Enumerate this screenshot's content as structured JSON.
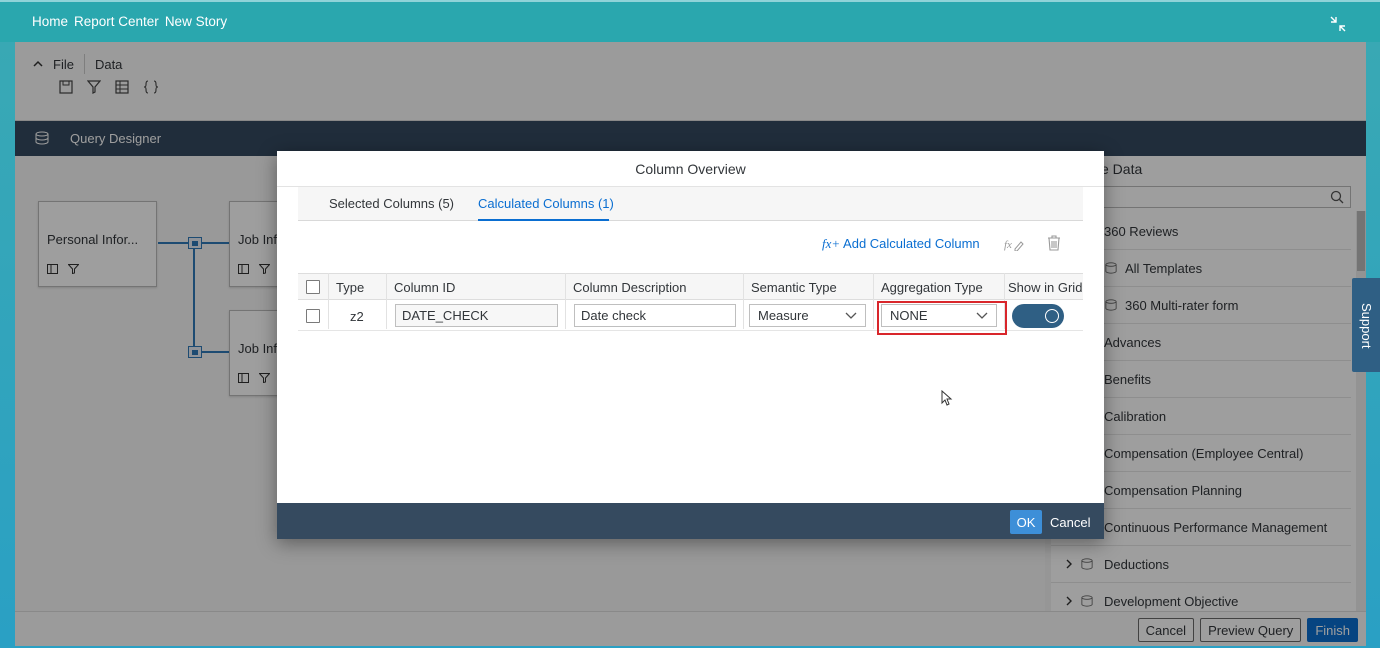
{
  "breadcrumb": [
    "Home",
    "Report Center",
    "New Story"
  ],
  "toolbar": {
    "file_label": "File",
    "data_label": "Data"
  },
  "query_designer": {
    "label": "Query Designer"
  },
  "canvas": {
    "nodes": [
      {
        "label": "Personal Infor..."
      },
      {
        "label": "Job Inf"
      },
      {
        "label": "Job Inf"
      }
    ]
  },
  "right_panel": {
    "title": "e Data",
    "items": [
      {
        "label": "360 Reviews"
      },
      {
        "label": "All Templates"
      },
      {
        "label": "360 Multi-rater form"
      },
      {
        "label": "Advances"
      },
      {
        "label": "Benefits"
      },
      {
        "label": "Calibration"
      },
      {
        "label": "Compensation (Employee Central)"
      },
      {
        "label": "Compensation Planning"
      },
      {
        "label": "Continuous Performance Management"
      },
      {
        "label": "Deductions"
      },
      {
        "label": "Development Objective"
      }
    ]
  },
  "support_tab": "Support",
  "footer": {
    "cancel": "Cancel",
    "preview": "Preview Query",
    "finish": "Finish"
  },
  "dialog": {
    "title": "Column Overview",
    "tabs": [
      {
        "label": "Selected Columns (5)"
      },
      {
        "label": "Calculated Columns (1)"
      }
    ],
    "add_calculated_fx": "fx+",
    "add_calculated_label": " Add Calculated Column",
    "columns": [
      "Type",
      "Column ID",
      "Column Description",
      "Semantic Type",
      "Aggregation Type",
      "Show in Grid"
    ],
    "row": {
      "type": "z2",
      "column_id": "DATE_CHECK",
      "description": "Date check",
      "semantic_type": "Measure",
      "aggregation_type": "NONE",
      "show_in_grid": true
    },
    "ok": "OK",
    "cancel": "Cancel"
  },
  "colors": {
    "accent": "#0a6ed1",
    "header_dark": "#354a5f",
    "topbar": "#2aa7ae",
    "highlight": "#d9262b"
  }
}
